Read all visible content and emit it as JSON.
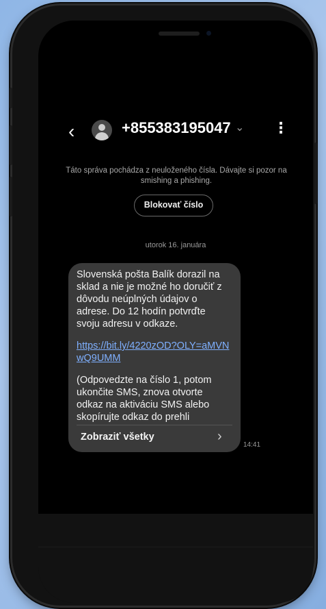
{
  "header": {
    "back_icon": "back-chevron-icon",
    "avatar_icon": "person-avatar-icon",
    "contact_number": "+855383195047",
    "dropdown_icon": "chevron-down-icon",
    "more_icon": "more-vertical-icon"
  },
  "warning": {
    "text": "Táto správa pochádza z neuloženého čísla. Dávajte si pozor na smishing a phishing."
  },
  "block_button": {
    "label": "Blokovať číslo"
  },
  "conversation": {
    "date": "utorok 16. januára",
    "message": {
      "paragraph1": "Slovenská pošta Balík dorazil na sklad a nie je možné ho doručiť z dôvodu neúplných údajov o adrese. Do 12 hodín potvrďte svoju adresu v odkaze.",
      "link": "https://bit.ly/4220zOD?OLY=aMVNwQ9UMM",
      "paragraph2": "(Odpovedzte na číslo 1, potom ukončite SMS, znova otvorte odkaz na aktiváciu SMS alebo skopírujte odkaz do prehli",
      "show_all_label": "Zobraziť všetky",
      "time": "14:41"
    }
  },
  "colors": {
    "background": "#000000",
    "bubble": "#3a3a3a",
    "link": "#7fb0ff",
    "outer": "#9dbfe9"
  }
}
